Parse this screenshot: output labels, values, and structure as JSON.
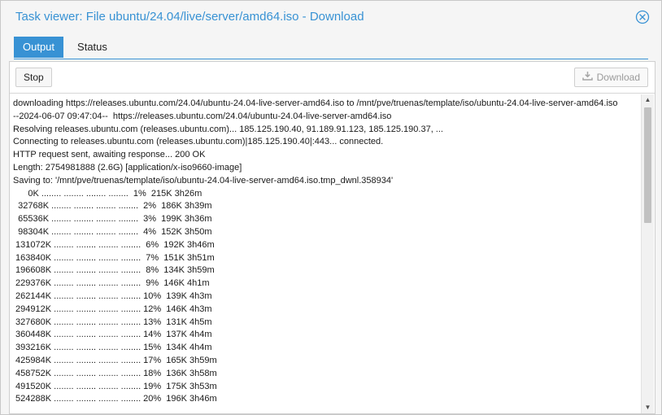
{
  "window": {
    "title": "Task viewer: File ubuntu/24.04/live/server/amd64.iso - Download"
  },
  "tabs": [
    {
      "label": "Output",
      "active": true
    },
    {
      "label": "Status",
      "active": false
    }
  ],
  "toolbar": {
    "stop_label": "Stop",
    "download_label": "Download"
  },
  "colors": {
    "accent": "#3892d4"
  },
  "icons": {
    "close": "close-circle-icon",
    "download": "download-icon",
    "scroll_up": "arrow-up-icon",
    "scroll_down": "arrow-down-icon"
  },
  "log_lines": [
    "downloading https://releases.ubuntu.com/24.04/ubuntu-24.04-live-server-amd64.iso to /mnt/pve/truenas/template/iso/ubuntu-24.04-live-server-amd64.iso",
    "--2024-06-07 09:47:04--  https://releases.ubuntu.com/24.04/ubuntu-24.04-live-server-amd64.iso",
    "Resolving releases.ubuntu.com (releases.ubuntu.com)... 185.125.190.40, 91.189.91.123, 185.125.190.37, ...",
    "Connecting to releases.ubuntu.com (releases.ubuntu.com)|185.125.190.40|:443... connected.",
    "HTTP request sent, awaiting response... 200 OK",
    "Length: 2754981888 (2.6G) [application/x-iso9660-image]",
    "Saving to: '/mnt/pve/truenas/template/iso/ubuntu-24.04-live-server-amd64.iso.tmp_dwnl.358934'",
    "      0K ........ ........ ........ ........  1%  215K 3h26m",
    "  32768K ........ ........ ........ ........  2%  186K 3h39m",
    "  65536K ........ ........ ........ ........  3%  199K 3h36m",
    "  98304K ........ ........ ........ ........  4%  152K 3h50m",
    " 131072K ........ ........ ........ ........  6%  192K 3h46m",
    " 163840K ........ ........ ........ ........  7%  151K 3h51m",
    " 196608K ........ ........ ........ ........  8%  134K 3h59m",
    " 229376K ........ ........ ........ ........  9%  146K 4h1m",
    " 262144K ........ ........ ........ ........ 10%  139K 4h3m",
    " 294912K ........ ........ ........ ........ 12%  146K 4h3m",
    " 327680K ........ ........ ........ ........ 13%  131K 4h5m",
    " 360448K ........ ........ ........ ........ 14%  137K 4h4m",
    " 393216K ........ ........ ........ ........ 15%  134K 4h4m",
    " 425984K ........ ........ ........ ........ 17%  165K 3h59m",
    " 458752K ........ ........ ........ ........ 18%  136K 3h58m",
    " 491520K ........ ........ ........ ........ 19%  175K 3h53m",
    " 524288K ........ ........ ........ ........ 20%  196K 3h46m"
  ]
}
